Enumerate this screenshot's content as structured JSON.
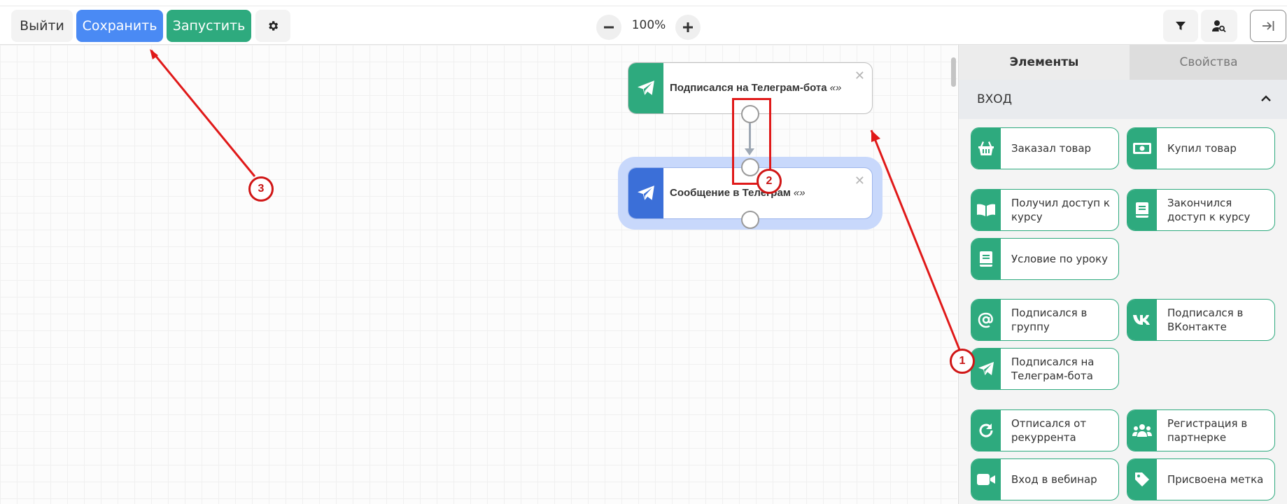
{
  "toolbar": {
    "exit_label": "Выйти",
    "save_label": "Сохранить",
    "run_label": "Запустить",
    "zoom_minus": "−",
    "zoom_value": "100%",
    "zoom_plus": "+"
  },
  "canvas": {
    "nodes": [
      {
        "title": "Подписался на Телеграм-бота",
        "suffix": "«»",
        "icon": "telegram-plane-icon",
        "strip_color": "#2eaa7e"
      },
      {
        "title": "Сообщение в Телеграм",
        "suffix": "«»",
        "icon": "telegram-plane-icon",
        "strip_color": "#3b6fd8"
      }
    ],
    "close_glyph": "✕"
  },
  "annotations": {
    "badges": [
      "1",
      "2",
      "3"
    ],
    "color": "#d01616"
  },
  "sidebar": {
    "tabs": [
      "Элементы",
      "Свойства"
    ],
    "section_title": "ВХОД",
    "items": [
      {
        "label": "Заказал товар",
        "icon": "basket-icon"
      },
      {
        "label": "Купил товар",
        "icon": "money-icon"
      },
      {
        "label": "Получил доступ к курсу",
        "icon": "open-book-icon"
      },
      {
        "label": "Закончился доступ к курсу",
        "icon": "book-icon"
      },
      {
        "label": "Условие по уроку",
        "icon": "book-icon"
      },
      {
        "label": "Подписался в группу",
        "icon": "at-icon"
      },
      {
        "label": "Подписался в ВКонтакте",
        "icon": "vk-icon"
      },
      {
        "label": "Подписался на Телеграм-бота",
        "icon": "telegram-plane-icon"
      },
      {
        "label": "Отписался от рекуррента",
        "icon": "redo-icon"
      },
      {
        "label": "Регистрация в партнерке",
        "icon": "users-icon"
      },
      {
        "label": "Вход в вебинар",
        "icon": "video-icon"
      },
      {
        "label": "Присвоена метка",
        "icon": "tag-icon"
      }
    ]
  },
  "colors": {
    "accent_green": "#2eaa7e",
    "accent_blue": "#4a8af4",
    "node_blue": "#3b6fd8"
  }
}
